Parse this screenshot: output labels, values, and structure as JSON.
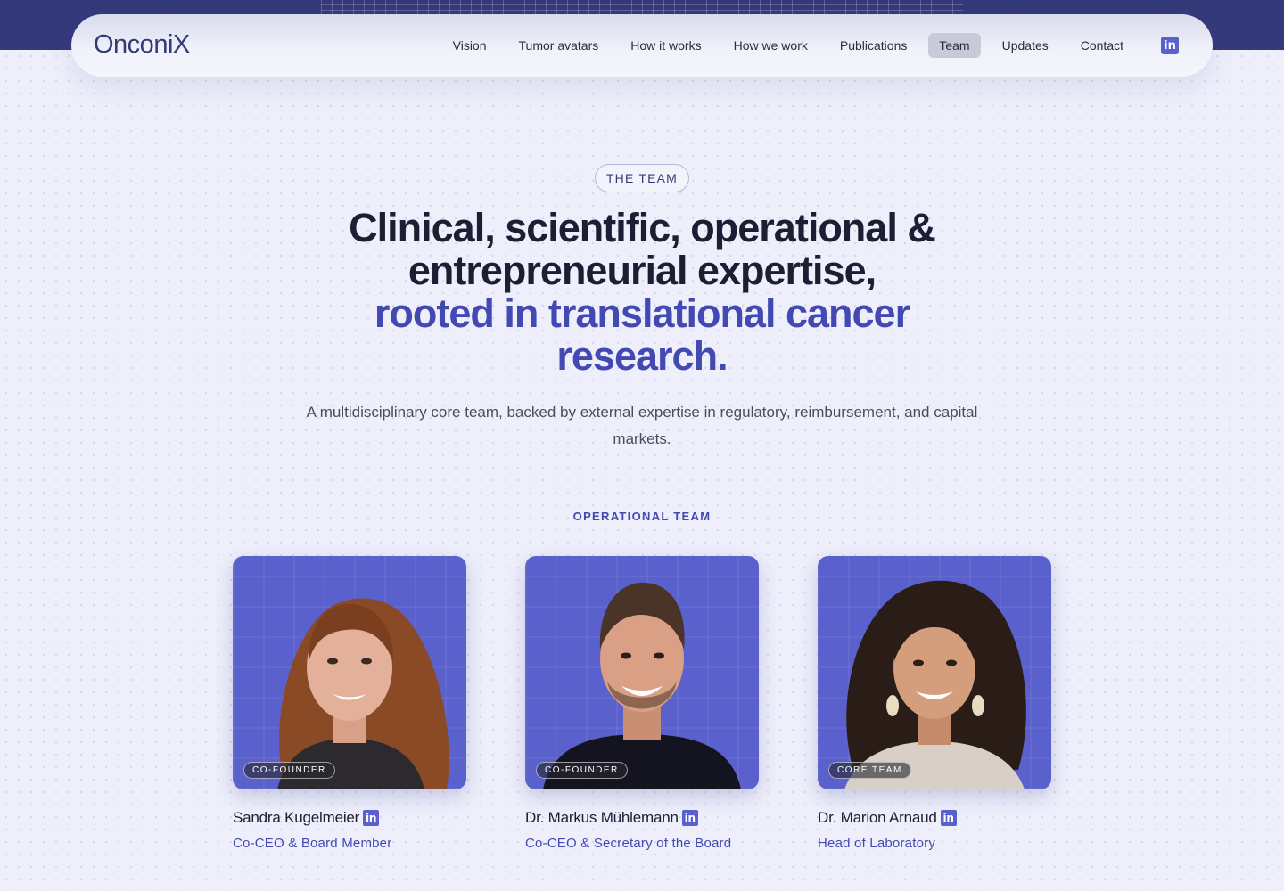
{
  "brand": {
    "logo": "OnconiX"
  },
  "nav": {
    "items": [
      {
        "label": "Vision"
      },
      {
        "label": "Tumor avatars"
      },
      {
        "label": "How it works"
      },
      {
        "label": "How we work"
      },
      {
        "label": "Publications"
      },
      {
        "label": "Team",
        "active": true
      },
      {
        "label": "Updates"
      },
      {
        "label": "Contact"
      }
    ],
    "linkedin_icon": "linkedin-icon",
    "linkedin_glyph": "in"
  },
  "hero": {
    "eyebrow": "THE TEAM",
    "headline_line1": "Clinical, scientific, operational &",
    "headline_line2": "entrepreneurial expertise,",
    "headline_accent_line1": "rooted in translational cancer",
    "headline_accent_line2": "research.",
    "subtitle": "A multidisciplinary core team, backed by external expertise in regulatory, reimbursement, and capital markets."
  },
  "team": {
    "section_label": "OPERATIONAL TEAM",
    "members": [
      {
        "name": "Sandra Kugelmeier",
        "role_badge": "CO-FOUNDER",
        "title": "Co-CEO & Board Member"
      },
      {
        "name": "Dr. Markus Mühlemann",
        "role_badge": "CO-FOUNDER",
        "title": "Co-CEO & Secretary of the Board"
      },
      {
        "name": "Dr. Marion Arnaud",
        "role_badge": "CORE TEAM",
        "title": "Head of Laboratory"
      }
    ]
  },
  "colors": {
    "accent": "#4349b3",
    "band": "#34397a",
    "photo_bg": "#5b61cc",
    "page_bg": "#eeeffb"
  }
}
